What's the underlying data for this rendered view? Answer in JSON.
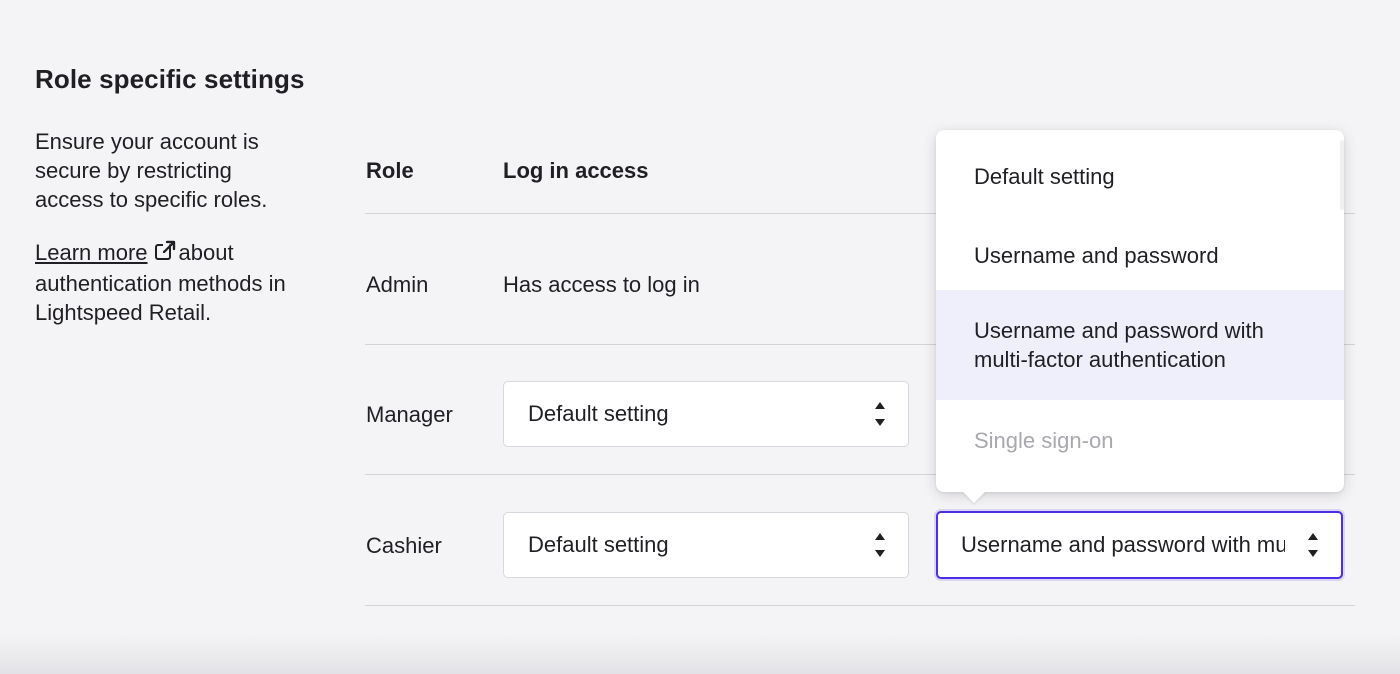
{
  "section": {
    "title": "Role specific settings",
    "description": "Ensure your account is secure by restricting access to specific roles.",
    "learn_more_link": "Learn more",
    "learn_more_suffix": "about authentication methods in Lightspeed Retail."
  },
  "table": {
    "headers": {
      "role": "Role",
      "login": "Log in access"
    },
    "rows": [
      {
        "role": "Admin",
        "login_text": "Has access to log in"
      },
      {
        "role": "Manager",
        "login_select": "Default setting"
      },
      {
        "role": "Cashier",
        "login_select": "Default setting",
        "auth_select": "Username and password with multi-factor authentication"
      }
    ]
  },
  "dropdown": {
    "options": [
      {
        "label": "Default setting",
        "state": "normal"
      },
      {
        "label": "Username and password",
        "state": "normal"
      },
      {
        "label": "Username and password with multi-factor authentication",
        "state": "hover"
      },
      {
        "label": "Single sign-on",
        "state": "disabled"
      }
    ]
  },
  "colors": {
    "focus_border": "#4b2ee6",
    "hover_bg": "#efeefb",
    "disabled_text": "#a9a8ae",
    "background": "#f4f3f5"
  }
}
